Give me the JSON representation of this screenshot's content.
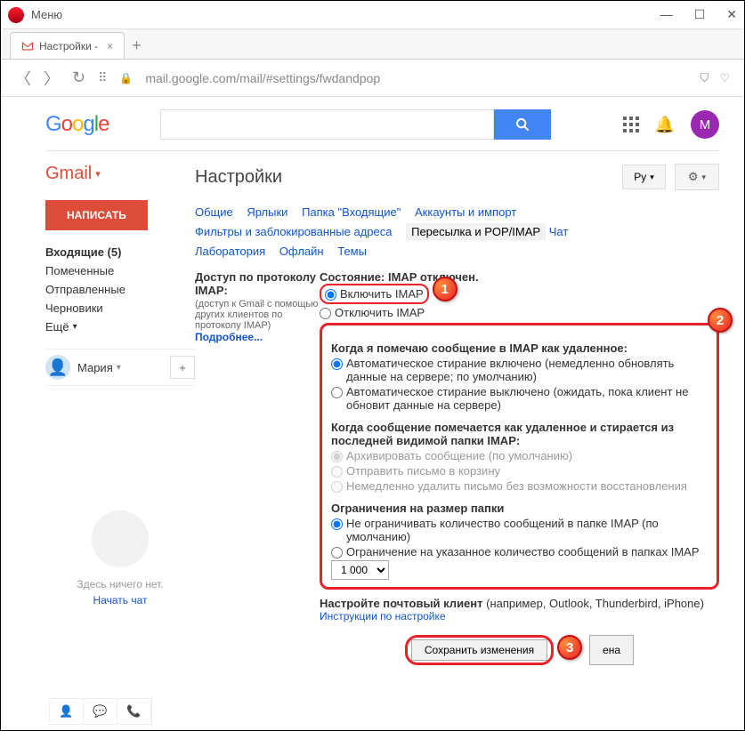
{
  "titlebar": {
    "menu": "Меню"
  },
  "tab": {
    "title": "Настройки -",
    "close": "×"
  },
  "addr": {
    "url": "mail.google.com/mail/#settings/fwdandpop"
  },
  "logo": {
    "g1": "G",
    "o1": "o",
    "o2": "o",
    "g2": "g",
    "l": "l",
    "e": "e"
  },
  "avatar": {
    "letter": "M"
  },
  "gmail": {
    "label": "Gmail",
    "compose": "НАПИСАТЬ"
  },
  "folders": {
    "inbox": "Входящие (5)",
    "starred": "Помеченные",
    "sent": "Отправленные",
    "drafts": "Черновики",
    "more": "Ещё"
  },
  "user": {
    "name": "Мария"
  },
  "hangouts": {
    "empty": "Здесь ничего нет.",
    "start": "Начать чат"
  },
  "page": {
    "title": "Настройки",
    "lang": "Ру"
  },
  "tabs": {
    "general": "Общие",
    "labels": "Ярлыки",
    "inbox": "Папка \"Входящие\"",
    "accounts": "Аккаунты и импорт",
    "filters": "Фильтры и заблокированные адреса",
    "forwarding": "Пересылка и POP/IMAP",
    "chat": "Чат",
    "labs": "Лаборатория",
    "offline": "Офлайн",
    "themes": "Темы"
  },
  "imap": {
    "heading": "Доступ по протоколу IMAP:",
    "sub": "(доступ к Gmail с помощью других клиентов по протоколу IMAP)",
    "more": "Подробнее...",
    "status": "Состояние: IMAP отключен.",
    "enable": "Включить IMAP",
    "disable": "Отключить IMAP",
    "deleteHead": "Когда я помечаю сообщение в IMAP как удаленное:",
    "autoOn": "Автоматическое стирание включено (немедленно обновлять данные на сервере; по умолчанию)",
    "autoOff": "Автоматическое стирание выключено (ожидать, пока клиент не обновит данные на сервере)",
    "expungeHead": "Когда сообщение помечается как удаленное и стирается из последней видимой папки IMAP:",
    "archive": "Архивировать сообщение (по умолчанию)",
    "trash": "Отправить письмо в корзину",
    "delete": "Немедленно удалить письмо без возможности восстановления",
    "limitHead": "Ограничения на размер папки",
    "nolimit": "Не ограничивать количество сообщений в папке IMAP (по умолчанию)",
    "limit": "Ограничение на указанное количество сообщений в папках IMAP",
    "limitVal": "1 000",
    "clientHead": "Настройте почтовый клиент",
    "clientSub": " (например, Outlook, Thunderbird, iPhone)",
    "instructions": "Инструкции по настройке"
  },
  "buttons": {
    "save": "Сохранить изменения",
    "cancel": "ена"
  },
  "callouts": {
    "one": "1",
    "two": "2",
    "three": "3"
  }
}
